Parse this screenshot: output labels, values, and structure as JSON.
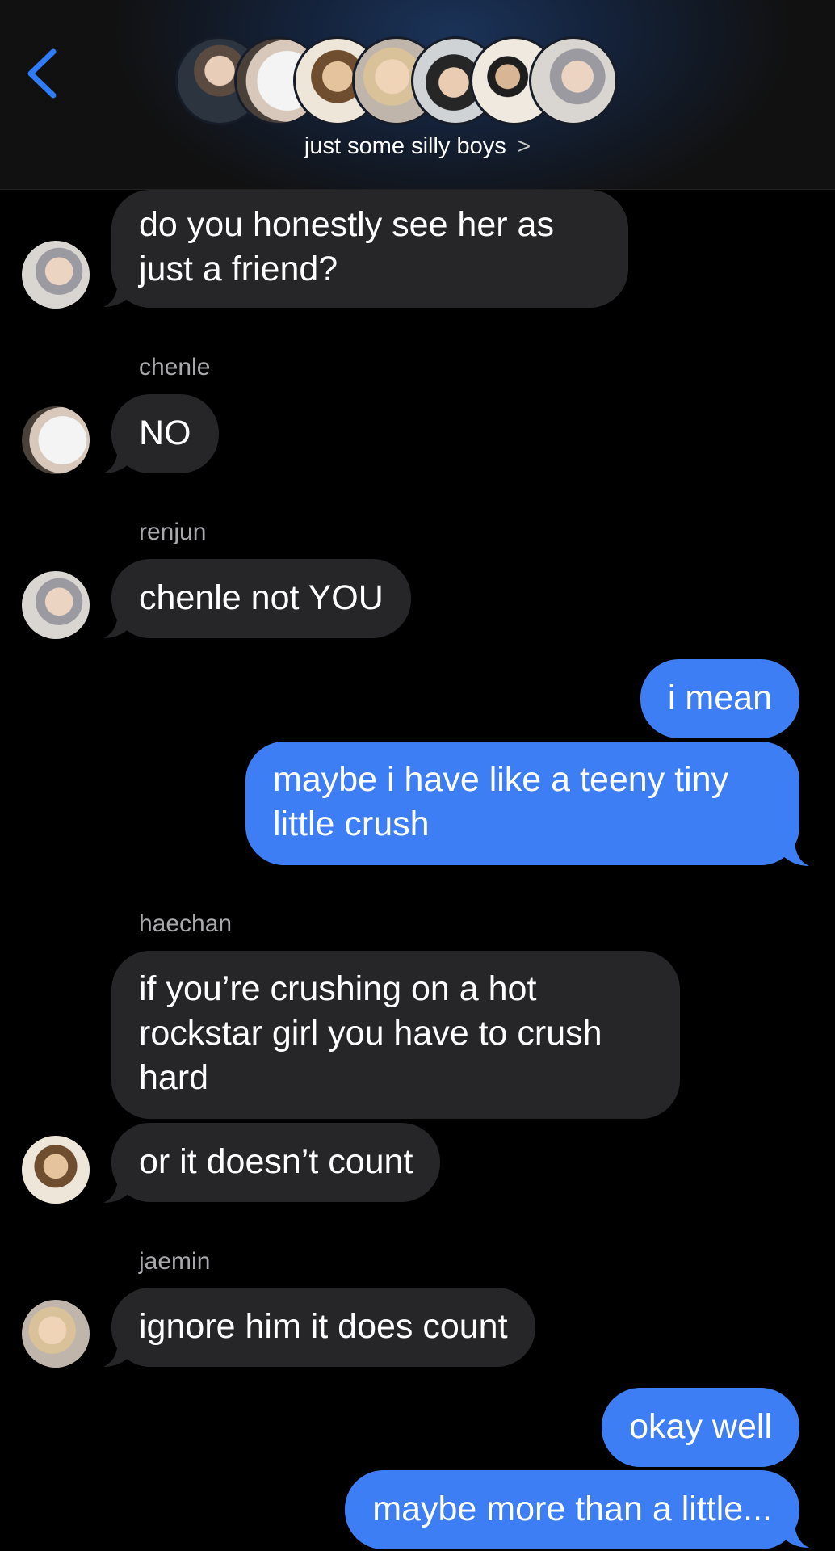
{
  "header": {
    "group_name": "just some silly boys",
    "member_avatars": [
      "member-1-avatar",
      "member-2-avatar",
      "member-3-avatar",
      "member-4-avatar",
      "member-5-avatar",
      "member-6-avatar",
      "member-7-avatar"
    ]
  },
  "messages": [
    {
      "lines": [
        "do you honestly see her as",
        "just a friend?"
      ]
    },
    {
      "sender": "chenle",
      "lines": [
        "NO"
      ]
    },
    {
      "sender": "renjun",
      "lines": [
        "chenle not YOU"
      ]
    },
    {
      "lines": [
        "i mean"
      ]
    },
    {
      "lines": [
        "maybe i have like a teeny tiny",
        "little crush"
      ]
    },
    {
      "sender": "haechan",
      "lines": [
        "if you’re crushing on a hot",
        "rockstar girl you have to crush",
        "hard"
      ]
    },
    {
      "lines": [
        "or it doesn’t count"
      ]
    },
    {
      "sender": "jaemin",
      "lines": [
        "ignore him it does count"
      ]
    },
    {
      "lines": [
        "okay well"
      ]
    },
    {
      "lines": [
        "maybe more than a little..."
      ]
    }
  ],
  "colors": {
    "incoming_bubble": "#262629",
    "outgoing_bubble": "#3d7ef5",
    "accent": "#2f7cf6"
  }
}
